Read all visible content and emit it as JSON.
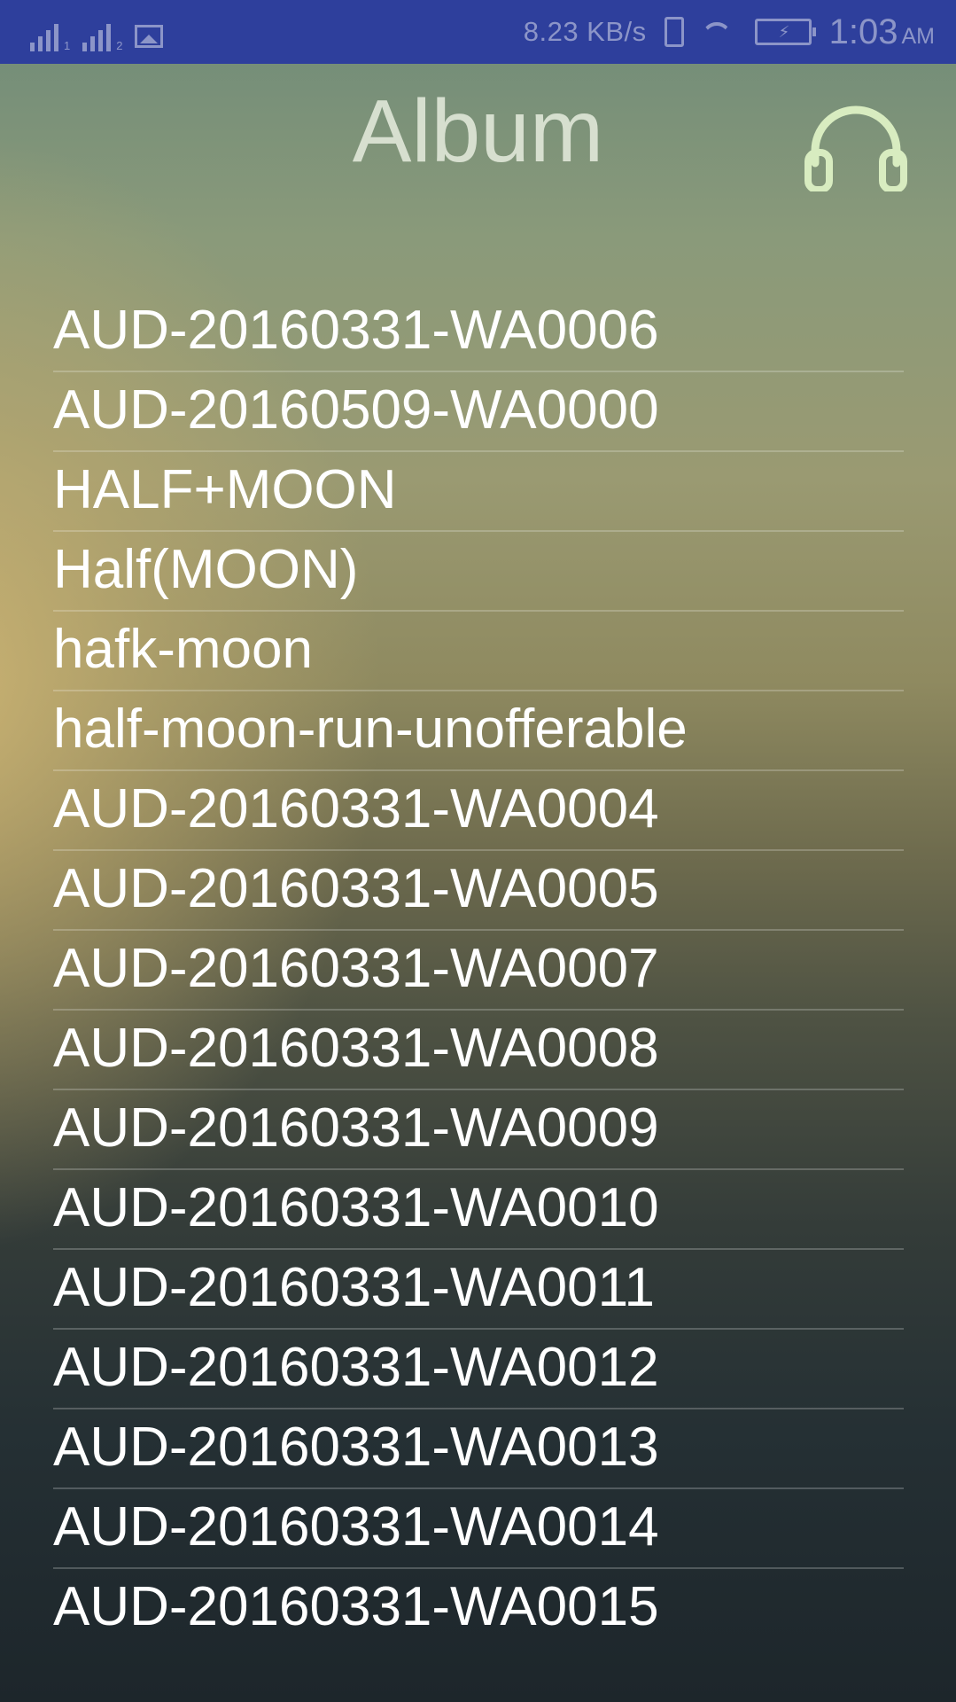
{
  "status_bar": {
    "sim1_label": "1",
    "sim2_label": "2",
    "network_speed": "8.23 KB/s",
    "time": "1:03",
    "ampm": "AM"
  },
  "header": {
    "title": "Album",
    "player_icon": "headphones-icon"
  },
  "songs": [
    "AUD-20160331-WA0006",
    "AUD-20160509-WA0000",
    "HALF+MOON",
    "Half(MOON)",
    "hafk-moon",
    "half-moon-run-unofferable",
    "AUD-20160331-WA0004",
    "AUD-20160331-WA0005",
    "AUD-20160331-WA0007",
    "AUD-20160331-WA0008",
    "AUD-20160331-WA0009",
    "AUD-20160331-WA0010",
    "AUD-20160331-WA0011",
    "AUD-20160331-WA0012",
    "AUD-20160331-WA0013",
    "AUD-20160331-WA0014",
    "AUD-20160331-WA0015"
  ],
  "colors": {
    "status_bar": "#2e3f9c",
    "headphones_icon": "#d8ecc0",
    "list_text": "#ffffff"
  }
}
